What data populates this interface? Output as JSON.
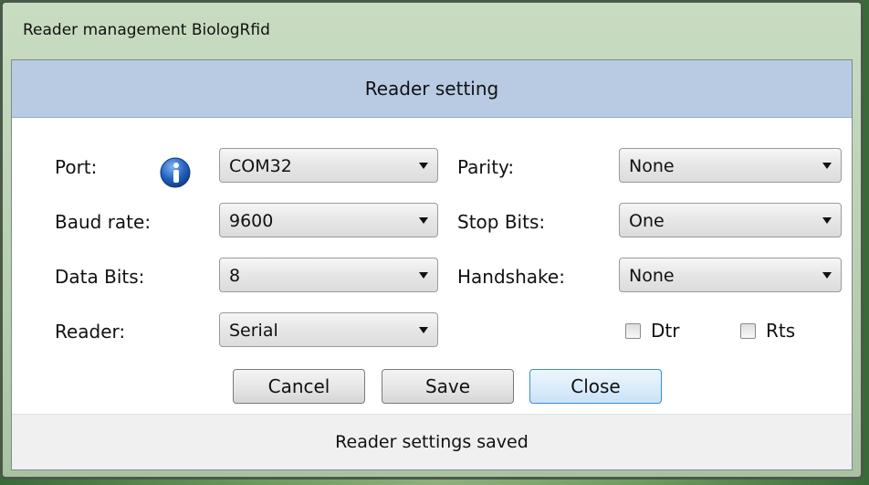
{
  "window": {
    "title": "Reader management BiologRfid"
  },
  "header": {
    "title": "Reader setting"
  },
  "form": {
    "port": {
      "label": "Port:",
      "value": "COM32"
    },
    "baud_rate": {
      "label": "Baud rate:",
      "value": "9600"
    },
    "data_bits": {
      "label": "Data Bits:",
      "value": "8"
    },
    "reader": {
      "label": "Reader:",
      "value": "Serial"
    },
    "parity": {
      "label": "Parity:",
      "value": "None"
    },
    "stop_bits": {
      "label": "Stop Bits:",
      "value": "One"
    },
    "handshake": {
      "label": "Handshake:",
      "value": "None"
    },
    "dtr": {
      "label": "Dtr",
      "checked": false
    },
    "rts": {
      "label": "Rts",
      "checked": false
    }
  },
  "buttons": {
    "cancel": "Cancel",
    "save": "Save",
    "close": "Close"
  },
  "status": {
    "text": "Reader settings saved"
  },
  "icons": {
    "port_info": "info-icon"
  },
  "colors": {
    "header_bg": "#b8cbe3",
    "focus_border": "#3b8fd4",
    "info_icon": "#1f5fb8"
  }
}
